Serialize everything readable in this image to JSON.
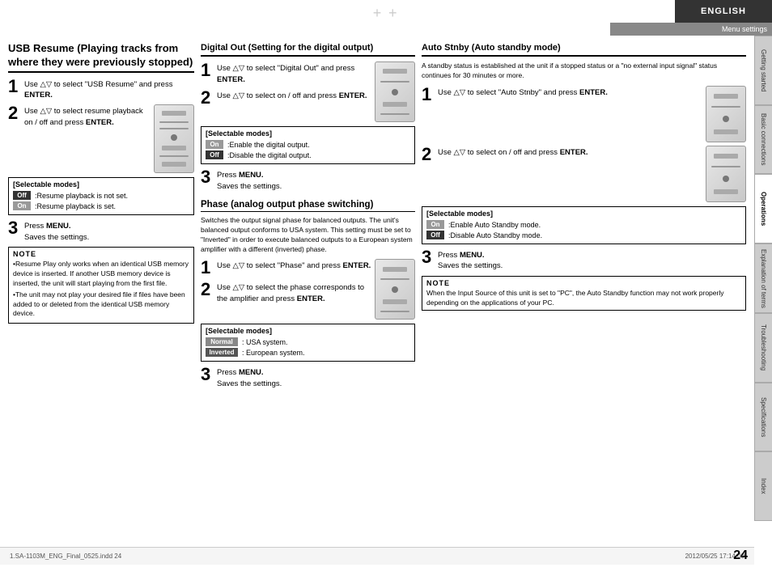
{
  "page": {
    "language": "ENGLISH",
    "menu_settings": "Menu settings",
    "page_number": "24",
    "footer_left": "1.SA-1103M_ENG_Final_0525.indd   24",
    "footer_right": "2012/05/25   17:14:00"
  },
  "tabs": [
    {
      "label": "Getting started",
      "active": false
    },
    {
      "label": "Basic connections",
      "active": false
    },
    {
      "label": "Operations",
      "active": true
    },
    {
      "label": "Explanation of terms",
      "active": false
    },
    {
      "label": "Troubleshooting",
      "active": false
    },
    {
      "label": "Specifications",
      "active": false
    },
    {
      "label": "Index",
      "active": false
    }
  ],
  "col_left": {
    "section_title": "USB Resume (Playing tracks from where they were previously stopped)",
    "step1": {
      "num": "1",
      "text": "Use △▽ to select \"USB Resume\" and press ",
      "bold": "ENTER."
    },
    "step2": {
      "num": "2",
      "text": "Use △▽ to select resume playback on / off and press ",
      "bold": "ENTER."
    },
    "modes_title": "[Selectable modes]",
    "modes": [
      {
        "badge": "Off",
        "text": ":Resume playback is not set."
      },
      {
        "badge": "On",
        "text": ":Resume playback is set."
      }
    ],
    "step3": {
      "num": "3",
      "press": "Press ",
      "menu": "MENU.",
      "saves": "Saves the settings."
    },
    "note_title": "NOTE",
    "note_items": [
      "Resume Play only works when an identical USB memory device is inserted. If another USB memory device is inserted, the unit will start playing from the first file.",
      "The unit may not play your desired file if files have been added to or deleted from the identical USB memory device."
    ]
  },
  "col_mid": {
    "section1_title": "Digital Out (Setting for the digital output)",
    "step1": {
      "num": "1",
      "text": "Use △▽ to select \"Digital Out\" and press ",
      "bold": "ENTER."
    },
    "step2": {
      "num": "2",
      "text": "Use △▽ to select on / off and press ",
      "bold": "ENTER."
    },
    "modes_title": "[Selectable modes]",
    "modes": [
      {
        "badge": "On",
        "text": ":Enable the digital output."
      },
      {
        "badge": "Off",
        "text": ":Disable the digital output."
      }
    ],
    "step3": {
      "num": "3",
      "press": "Press ",
      "menu": "MENU.",
      "saves": "Saves the settings."
    },
    "section2_title": "Phase (analog output phase switching)",
    "phase_desc": "Switches the output signal phase for balanced outputs. The unit's balanced output conforms to USA system. This setting must be set to \"Inverted\" in order to execute balanced outputs to a European system amplifier with a different (inverted) phase.",
    "step_p1": {
      "num": "1",
      "text": "Use △▽ to select \"Phase\" and press ",
      "bold": "ENTER."
    },
    "step_p2": {
      "num": "2",
      "text": "Use △▽ to select the phase corresponds to the amplifier and press ",
      "bold": "ENTER."
    },
    "modes_p_title": "[Selectable modes]",
    "modes_p": [
      {
        "badge": "Normal",
        "text": ": USA system."
      },
      {
        "badge": "Inverted",
        "text": ": European system."
      }
    ],
    "step_p3": {
      "num": "3",
      "press": "Press ",
      "menu": "MENU.",
      "saves": "Saves the settings."
    }
  },
  "col_right": {
    "section_title": "Auto Stnby (Auto standby mode)",
    "intro": "A standby status is established at the unit if a stopped status or a \"no external input signal\" status continues for 30 minutes or more.",
    "step1": {
      "num": "1",
      "text": "Use △▽ to select \"Auto Stnby\" and press ",
      "bold": "ENTER."
    },
    "step2": {
      "num": "2",
      "text": "Use △▽ to select on / off and press ",
      "bold": "ENTER."
    },
    "modes_title": "[Selectable modes]",
    "modes": [
      {
        "badge": "On",
        "text": ":Enable Auto Standby mode."
      },
      {
        "badge": "Off",
        "text": ":Disable Auto Standby mode."
      }
    ],
    "step3": {
      "num": "3",
      "press": "Press ",
      "menu": "MENU.",
      "saves": "Saves the settings."
    },
    "note_title": "NOTE",
    "note_text": "When the Input Source of this unit is set to \"PC\", the Auto Standby function may not work properly depending on the applications of your PC."
  }
}
